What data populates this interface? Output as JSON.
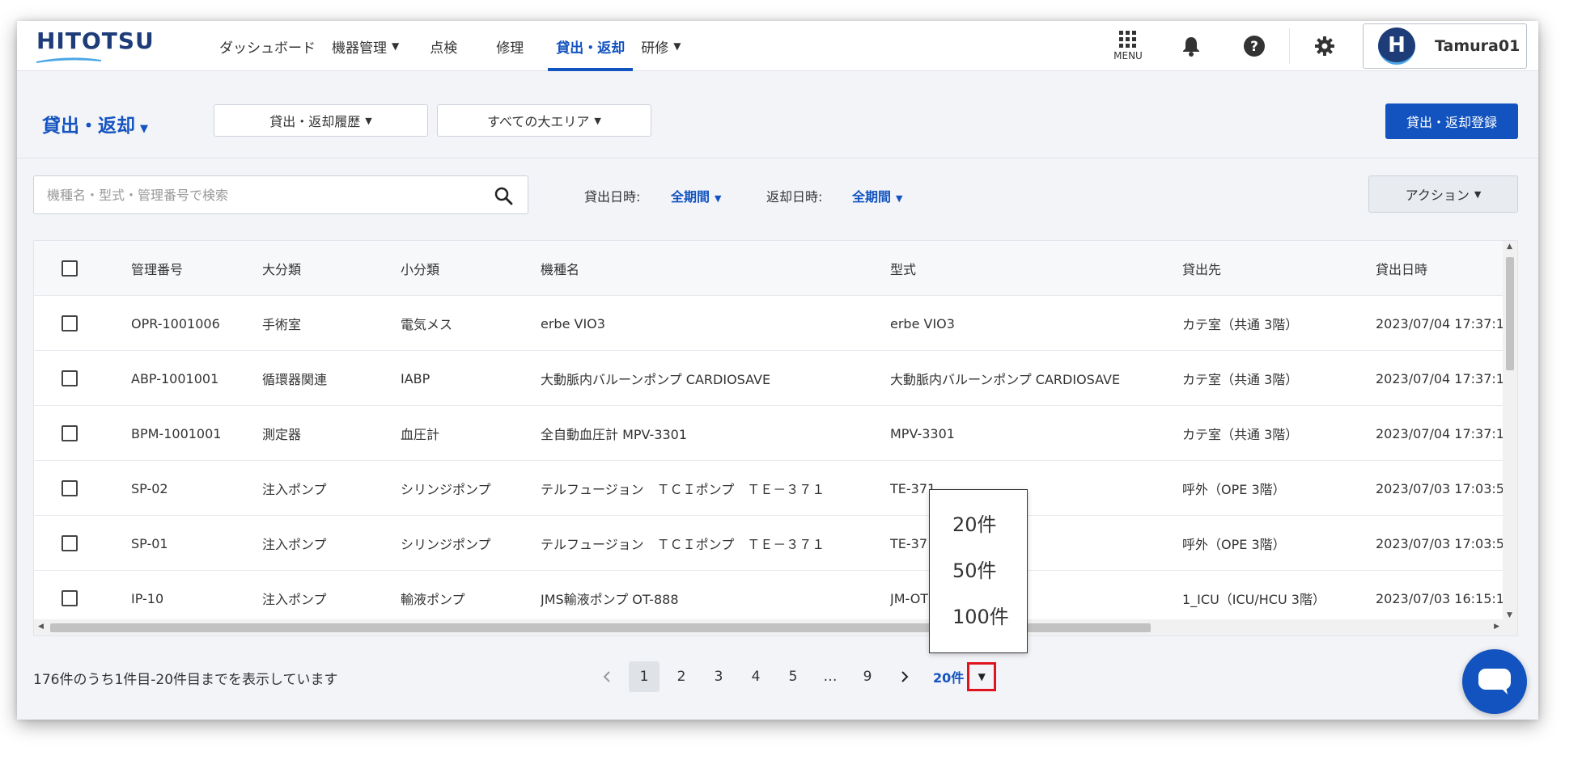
{
  "header": {
    "logo": "HITOTSU",
    "nav": [
      {
        "label": "ダッシュボード",
        "dropdown": false,
        "active": false
      },
      {
        "label": "機器管理",
        "dropdown": true,
        "active": false
      },
      {
        "label": "点検",
        "dropdown": false,
        "active": false
      },
      {
        "label": "修理",
        "dropdown": false,
        "active": false
      },
      {
        "label": "貸出・返却",
        "dropdown": false,
        "active": true
      },
      {
        "label": "研修",
        "dropdown": true,
        "active": false
      }
    ],
    "menu_label": "MENU",
    "user": {
      "initial": "H",
      "name": "Tamura01"
    }
  },
  "toolbar": {
    "page_title": "貸出・返却",
    "history_dropdown": "貸出・返却履歴",
    "area_dropdown": "すべての大エリア",
    "register_button": "貸出・返却登録"
  },
  "filters": {
    "search_placeholder": "機種名・型式・管理番号で検索",
    "checkout_label": "貸出日時:",
    "checkout_value": "全期間",
    "return_label": "返却日時:",
    "return_value": "全期間",
    "action_button": "アクション"
  },
  "table": {
    "columns": [
      "管理番号",
      "大分類",
      "小分類",
      "機種名",
      "型式",
      "貸出先",
      "貸出日時"
    ],
    "rows": [
      [
        "OPR-1001006",
        "手術室",
        "電気メス",
        "erbe VIO3",
        "erbe VIO3",
        "カテ室（共通 3階）",
        "2023/07/04 17:37:1"
      ],
      [
        "ABP-1001001",
        "循環器関連",
        "IABP",
        "大動脈内バルーンポンプ CARDIOSAVE",
        "大動脈内バルーンポンプ CARDIOSAVE",
        "カテ室（共通 3階）",
        "2023/07/04 17:37:1"
      ],
      [
        "BPM-1001001",
        "測定器",
        "血圧計",
        "全自動血圧計 MPV-3301",
        "MPV-3301",
        "カテ室（共通 3階）",
        "2023/07/04 17:37:1"
      ],
      [
        "SP-02",
        "注入ポンプ",
        "シリンジポンプ",
        "テルフュージョン　ＴＣＩポンプ　ＴＥ－３７１",
        "TE-371",
        "呼外（OPE 3階）",
        "2023/07/03 17:03:5"
      ],
      [
        "SP-01",
        "注入ポンプ",
        "シリンジポンプ",
        "テルフュージョン　ＴＣＩポンプ　ＴＥ－３７１",
        "TE-37",
        "呼外（OPE 3階）",
        "2023/07/03 17:03:5"
      ],
      [
        "IP-10",
        "注入ポンプ",
        "輸液ポンプ",
        "JMS輸液ポンプ OT-888",
        "JM-OT",
        "1_ICU（ICU/HCU 3階）",
        "2023/07/03 16:15:1"
      ]
    ]
  },
  "pagination": {
    "result_text": "176件のうち1件目-20件目までを表示しています",
    "pages": [
      "1",
      "2",
      "3",
      "4",
      "5",
      "…",
      "9"
    ],
    "current": "1",
    "per_page": "20件",
    "per_page_options": [
      "20件",
      "50件",
      "100件"
    ]
  },
  "colors": {
    "accent": "#1353c0",
    "logo": "#1d3c78",
    "highlight": "#e0141e"
  }
}
